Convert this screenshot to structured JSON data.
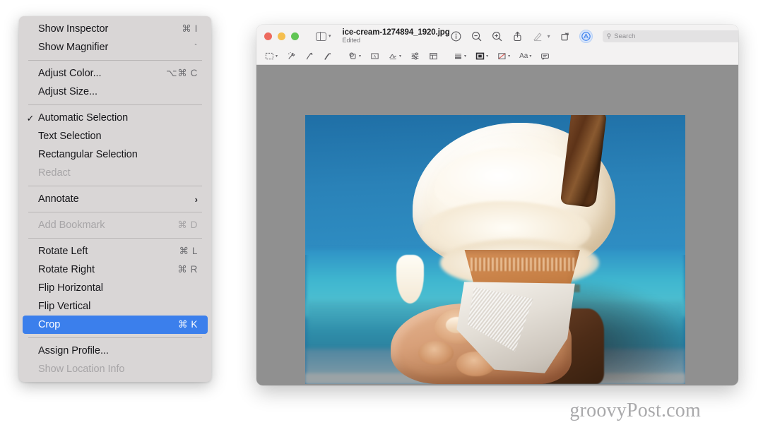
{
  "menu": {
    "name": "preview-tools-context-menu",
    "items": [
      {
        "type": "item",
        "label": "Show Inspector",
        "shortcut": "⌘ I",
        "checked": false,
        "disabled": false,
        "selected": false,
        "submenu": false
      },
      {
        "type": "item",
        "label": "Show Magnifier",
        "shortcut": "`",
        "checked": false,
        "disabled": false,
        "selected": false,
        "submenu": false
      },
      {
        "type": "separator"
      },
      {
        "type": "item",
        "label": "Adjust Color...",
        "shortcut": "⌥⌘ C",
        "checked": false,
        "disabled": false,
        "selected": false,
        "submenu": false
      },
      {
        "type": "item",
        "label": "Adjust Size...",
        "shortcut": "",
        "checked": false,
        "disabled": false,
        "selected": false,
        "submenu": false
      },
      {
        "type": "separator"
      },
      {
        "type": "item",
        "label": "Automatic Selection",
        "shortcut": "",
        "checked": true,
        "disabled": false,
        "selected": false,
        "submenu": false
      },
      {
        "type": "item",
        "label": "Text Selection",
        "shortcut": "",
        "checked": false,
        "disabled": false,
        "selected": false,
        "submenu": false
      },
      {
        "type": "item",
        "label": "Rectangular Selection",
        "shortcut": "",
        "checked": false,
        "disabled": false,
        "selected": false,
        "submenu": false
      },
      {
        "type": "item",
        "label": "Redact",
        "shortcut": "",
        "checked": false,
        "disabled": true,
        "selected": false,
        "submenu": false
      },
      {
        "type": "separator"
      },
      {
        "type": "item",
        "label": "Annotate",
        "shortcut": "",
        "checked": false,
        "disabled": false,
        "selected": false,
        "submenu": true
      },
      {
        "type": "separator"
      },
      {
        "type": "item",
        "label": "Add Bookmark",
        "shortcut": "⌘ D",
        "checked": false,
        "disabled": true,
        "selected": false,
        "submenu": false
      },
      {
        "type": "separator"
      },
      {
        "type": "item",
        "label": "Rotate Left",
        "shortcut": "⌘ L",
        "checked": false,
        "disabled": false,
        "selected": false,
        "submenu": false
      },
      {
        "type": "item",
        "label": "Rotate Right",
        "shortcut": "⌘ R",
        "checked": false,
        "disabled": false,
        "selected": false,
        "submenu": false
      },
      {
        "type": "item",
        "label": "Flip Horizontal",
        "shortcut": "",
        "checked": false,
        "disabled": false,
        "selected": false,
        "submenu": false
      },
      {
        "type": "item",
        "label": "Flip Vertical",
        "shortcut": "",
        "checked": false,
        "disabled": false,
        "selected": false,
        "submenu": false
      },
      {
        "type": "item",
        "label": "Crop",
        "shortcut": "⌘ K",
        "checked": false,
        "disabled": false,
        "selected": true,
        "submenu": false
      },
      {
        "type": "separator"
      },
      {
        "type": "item",
        "label": "Assign Profile...",
        "shortcut": "",
        "checked": false,
        "disabled": false,
        "selected": false,
        "submenu": false
      },
      {
        "type": "item",
        "label": "Show Location Info",
        "shortcut": "",
        "checked": false,
        "disabled": true,
        "selected": false,
        "submenu": false
      }
    ],
    "check_glyph": "✓",
    "submenu_glyph": "›",
    "highlight_color": "#3b7fec",
    "background_color": "#d9d6d6"
  },
  "window": {
    "title": "ice-cream-1274894_1920.jpg",
    "subtitle": "Edited",
    "traffic_lights": [
      {
        "name": "close",
        "color": "#ed6a5e"
      },
      {
        "name": "minimize",
        "color": "#f5bf4f"
      },
      {
        "name": "zoom",
        "color": "#61c554"
      }
    ],
    "sidebar_button": "sidebar-toggle",
    "toolbar_right": [
      {
        "icon": "info-icon",
        "label": "Info",
        "disabled": false
      },
      {
        "icon": "zoom-out-icon",
        "label": "Zoom Out",
        "disabled": false
      },
      {
        "icon": "zoom-in-icon",
        "label": "Zoom In",
        "disabled": false
      },
      {
        "icon": "share-icon",
        "label": "Share",
        "disabled": false
      },
      {
        "icon": "markup-pen-icon",
        "label": "Markup",
        "disabled": true
      },
      {
        "icon": "rotate-icon",
        "label": "Rotate",
        "disabled": false
      },
      {
        "icon": "markup-toggle-icon",
        "label": "Show Markup Toolbar",
        "disabled": false
      }
    ],
    "search": {
      "placeholder": "Search",
      "value": ""
    },
    "markup_toolbar": [
      {
        "icon": "selection-tools-icon",
        "label": "Selection Tools",
        "dropdown": true
      },
      {
        "icon": "instant-alpha-icon",
        "label": "Instant Alpha",
        "dropdown": false
      },
      {
        "icon": "sketch-icon",
        "label": "Sketch",
        "dropdown": false
      },
      {
        "icon": "draw-icon",
        "label": "Draw",
        "dropdown": false
      },
      {
        "icon": "shapes-icon",
        "label": "Shapes",
        "dropdown": true
      },
      {
        "icon": "text-box-icon",
        "label": "Text",
        "dropdown": false
      },
      {
        "icon": "sign-icon",
        "label": "Sign",
        "dropdown": true
      },
      {
        "icon": "adjust-color-icon",
        "label": "Adjust Color",
        "dropdown": false
      },
      {
        "icon": "adjust-size-icon",
        "label": "Adjust Size",
        "dropdown": false
      },
      {
        "icon": "shape-style-icon",
        "label": "Shape Style",
        "dropdown": true
      },
      {
        "icon": "border-color-icon",
        "label": "Border Color",
        "dropdown": true
      },
      {
        "icon": "fill-color-icon",
        "label": "Fill Color",
        "dropdown": true
      },
      {
        "icon": "text-style-icon",
        "label": "Text Style",
        "dropdown": true
      },
      {
        "icon": "annotate-note-icon",
        "label": "Add Note",
        "dropdown": false
      }
    ],
    "text_style_label": "Aa",
    "canvas_color": "#909090"
  },
  "photo": {
    "alt": "Soft-serve ice cream cone with chocolate flake held in a hand against a blue sea and sky background"
  },
  "watermark": {
    "text": "groovyPost.com"
  }
}
